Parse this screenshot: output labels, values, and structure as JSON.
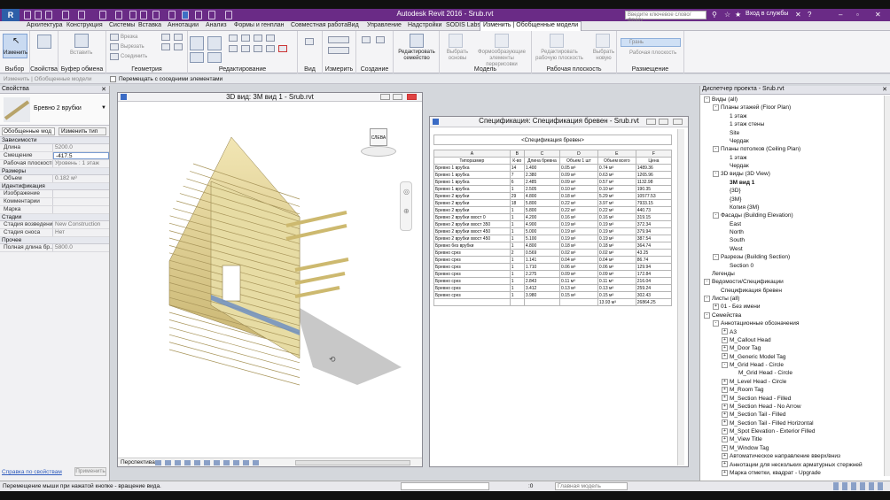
{
  "app": {
    "title": "Autodesk Revit 2016  -   Srub.rvt",
    "search_placeholder": "Введите ключевое слово/фразу",
    "signin": "Вход в службы"
  },
  "tabs": [
    "Архитектура",
    "Конструкция",
    "Системы",
    "Вставка",
    "Аннотации",
    "Анализ",
    "Формы и генплан",
    "Совместная работа",
    "Вид",
    "Управление",
    "Надстройки",
    "SODIS Labs",
    "Изменить | Обобщенные модели"
  ],
  "ribbon": {
    "groups": [
      "Выбор",
      "Свойства",
      "Буфер обмена",
      "Геометрия",
      "Редактирование",
      "Вид",
      "Измерить",
      "Создание",
      "Модель",
      "Рабочая плоскость",
      "Размещение"
    ],
    "buttons": {
      "modify": "Изменить",
      "properties": "Свойства",
      "paste": "Вставить",
      "cut": "Вырезать",
      "join": "Соединить",
      "cope": "Врезка",
      "edit_family": "Редактировать семейство",
      "select_hosts": "Выбрать основы",
      "load_profiles": "Формообразующие элементы перерисовки",
      "edit_workplane": "Редактировать рабочую плоскость",
      "pick_new": "Выбрать новую",
      "host": "Грань",
      "workplane_placement": "Рабочая плоскость"
    }
  },
  "optionbar": {
    "check": "Перемещать с соседними элементами",
    "left": "Изменить | Обобщенные модели"
  },
  "properties": {
    "header": "Свойства",
    "type_name": "Бревно 2 врубки",
    "filter": "Обобщенные мод",
    "edit_type": "Изменить тип",
    "sections": [
      {
        "name": "Зависимости",
        "rows": [
          [
            "Длина",
            "5200.0"
          ],
          [
            "Смещение",
            "-417.5"
          ],
          [
            "Рабочая плоскость",
            "Уровень : 1 этаж"
          ]
        ]
      },
      {
        "name": "Размеры",
        "rows": [
          [
            "Объем",
            "0.182 м³"
          ]
        ]
      },
      {
        "name": "Идентификация",
        "rows": [
          [
            "Изображение",
            ""
          ],
          [
            "Комментарии",
            ""
          ],
          [
            "Марка",
            ""
          ]
        ]
      },
      {
        "name": "Стадии",
        "rows": [
          [
            "Стадия возведения",
            "New Construction"
          ],
          [
            "Стадия сноса",
            "Нет"
          ]
        ]
      },
      {
        "name": "Прочее",
        "rows": [
          [
            "Полная длина бр...",
            "5800.0"
          ]
        ]
      }
    ],
    "help": "Справка по свойствам",
    "apply": "Применить"
  },
  "view3d": {
    "title": "3D вид: 3М вид 1 - Srub.rvt",
    "viewcube": "СЛЕВА",
    "footer": "Перспектива"
  },
  "spec": {
    "title": "Спецификация: Спецификация бревен - Srub.rvt",
    "caption": "<Спецификация бревен>",
    "letters": [
      "A",
      "B",
      "C",
      "D",
      "E",
      "F"
    ],
    "headers": [
      "Типоразмер",
      "К-во",
      "Длина бревна",
      "Объем 1 шт",
      "Объем всего",
      "Цена"
    ],
    "rows": [
      [
        "Бревно 1 врубка",
        "14",
        "1.400",
        "0.05 м³",
        "0.74 м³",
        "1489.36"
      ],
      [
        "Бревно 1 врубка",
        "7",
        "2.380",
        "0.09 м³",
        "0.63 м³",
        "1265.96"
      ],
      [
        "Бревно 1 врубка",
        "6",
        "2.485",
        "0.09 м³",
        "0.57 м³",
        "1132.98"
      ],
      [
        "Бревно 1 врубка",
        "1",
        "2.505",
        "0.10 м³",
        "0.10 м³",
        "190.35"
      ],
      [
        "Бревно 2 врубки",
        "29",
        "4.800",
        "0.18 м³",
        "5.29 м³",
        "10577.53"
      ],
      [
        "Бревно 2 врубки",
        "18",
        "5.800",
        "0.22 м³",
        "3.97 м³",
        "7933.15"
      ],
      [
        "Бревно 2 врубки",
        "1",
        "5.800",
        "0.22 м³",
        "0.22 м³",
        "440.73"
      ],
      [
        "Бревно 2 врубки хвост 0",
        "1",
        "4.200",
        "0.16 м³",
        "0.16 м³",
        "319.15"
      ],
      [
        "Бревно 2 врубки хвост 350",
        "1",
        "4.900",
        "0.19 м³",
        "0.19 м³",
        "372.34"
      ],
      [
        "Бревно 2 врубки хвост 450",
        "1",
        "5.000",
        "0.19 м³",
        "0.19 м³",
        "379.94"
      ],
      [
        "Бревно 2 врубки хвост 450",
        "1",
        "5.100",
        "0.19 м³",
        "0.19 м³",
        "387.54"
      ],
      [
        "Бревно без врубки",
        "1",
        "4.800",
        "0.18 м³",
        "0.18 м³",
        "364.74"
      ],
      [
        "Бревно срез",
        "2",
        "0.569",
        "0.02 м³",
        "0.02 м³",
        "43.25"
      ],
      [
        "Бревно срез",
        "1",
        "1.141",
        "0.04 м³",
        "0.04 м³",
        "86.74"
      ],
      [
        "Бревно срез",
        "1",
        "1.710",
        "0.06 м³",
        "0.06 м³",
        "129.94"
      ],
      [
        "Бревно срез",
        "1",
        "2.275",
        "0.09 м³",
        "0.09 м³",
        "172.84"
      ],
      [
        "Бревно срез",
        "1",
        "2.843",
        "0.11 м³",
        "0.11 м³",
        "216.04"
      ],
      [
        "Бревно срез",
        "1",
        "3.412",
        "0.13 м³",
        "0.13 м³",
        "259.24"
      ],
      [
        "Бревно срез",
        "1",
        "3.980",
        "0.15 м³",
        "0.15 м³",
        "302.43"
      ]
    ],
    "totals": [
      "",
      "",
      "",
      "",
      "13.93 м³",
      "26864.25"
    ]
  },
  "browser": {
    "header": "Диспетчер проекта - Srub.rvt",
    "nodes": [
      {
        "t": "Виды (all)",
        "d": 0,
        "g": "-"
      },
      {
        "t": "Планы этажей (Floor Plan)",
        "d": 1,
        "g": "-"
      },
      {
        "t": "1 этаж",
        "d": 2,
        "g": ""
      },
      {
        "t": "1 этаж стены",
        "d": 2,
        "g": ""
      },
      {
        "t": "Site",
        "d": 2,
        "g": ""
      },
      {
        "t": "Чердак",
        "d": 2,
        "g": ""
      },
      {
        "t": "Планы потолков (Ceiling Plan)",
        "d": 1,
        "g": "-"
      },
      {
        "t": "1 этаж",
        "d": 2,
        "g": ""
      },
      {
        "t": "Чердак",
        "d": 2,
        "g": ""
      },
      {
        "t": "3D виды (3D View)",
        "d": 1,
        "g": "-"
      },
      {
        "t": "3М вид 1",
        "d": 2,
        "g": "",
        "b": true
      },
      {
        "t": "{3D}",
        "d": 2,
        "g": ""
      },
      {
        "t": "{3М}",
        "d": 2,
        "g": ""
      },
      {
        "t": "Копия {3М}",
        "d": 2,
        "g": ""
      },
      {
        "t": "Фасады (Building Elevation)",
        "d": 1,
        "g": "-"
      },
      {
        "t": "East",
        "d": 2,
        "g": ""
      },
      {
        "t": "North",
        "d": 2,
        "g": ""
      },
      {
        "t": "South",
        "d": 2,
        "g": ""
      },
      {
        "t": "West",
        "d": 2,
        "g": ""
      },
      {
        "t": "Разрезы (Building Section)",
        "d": 1,
        "g": "-"
      },
      {
        "t": "Section 0",
        "d": 2,
        "g": ""
      },
      {
        "t": "Легенды",
        "d": 0,
        "g": ""
      },
      {
        "t": "Ведомости/Спецификации",
        "d": 0,
        "g": "-"
      },
      {
        "t": "Спецификация бревен",
        "d": 1,
        "g": ""
      },
      {
        "t": "Листы (all)",
        "d": 0,
        "g": "-"
      },
      {
        "t": "01 - Без имени",
        "d": 1,
        "g": "+"
      },
      {
        "t": "Семейства",
        "d": 0,
        "g": "-"
      },
      {
        "t": "Аннотационные обозначения",
        "d": 1,
        "g": "-"
      },
      {
        "t": "A3",
        "d": 2,
        "g": "+"
      },
      {
        "t": "M_Callout Head",
        "d": 2,
        "g": "+"
      },
      {
        "t": "M_Door Tag",
        "d": 2,
        "g": "+"
      },
      {
        "t": "M_Generic Model Tag",
        "d": 2,
        "g": "+"
      },
      {
        "t": "M_Grid Head - Circle",
        "d": 2,
        "g": "-"
      },
      {
        "t": "M_Grid Head - Circle",
        "d": 3,
        "g": ""
      },
      {
        "t": "M_Level Head - Circle",
        "d": 2,
        "g": "+"
      },
      {
        "t": "M_Room Tag",
        "d": 2,
        "g": "+"
      },
      {
        "t": "M_Section Head - Filled",
        "d": 2,
        "g": "+"
      },
      {
        "t": "M_Section Head - No Arrow",
        "d": 2,
        "g": "+"
      },
      {
        "t": "M_Section Tail - Filled",
        "d": 2,
        "g": "+"
      },
      {
        "t": "M_Section Tail - Filled Horizontal",
        "d": 2,
        "g": "+"
      },
      {
        "t": "M_Spot Elevation - Exterior Filled",
        "d": 2,
        "g": "+"
      },
      {
        "t": "M_View Title",
        "d": 2,
        "g": "+"
      },
      {
        "t": "M_Window Tag",
        "d": 2,
        "g": "+"
      },
      {
        "t": "Автоматическое направление вверх/вниз",
        "d": 2,
        "g": "+"
      },
      {
        "t": "Аннотации для нескольких арматурных стержней",
        "d": 2,
        "g": "+"
      },
      {
        "t": "Марка отметки, квадрат - Upgrade",
        "d": 2,
        "g": "+"
      }
    ]
  },
  "status": {
    "text": "Перемещение мыши при нажатой кнопке - вращение вида.",
    "zero": ":0",
    "model": "Главная модель"
  }
}
